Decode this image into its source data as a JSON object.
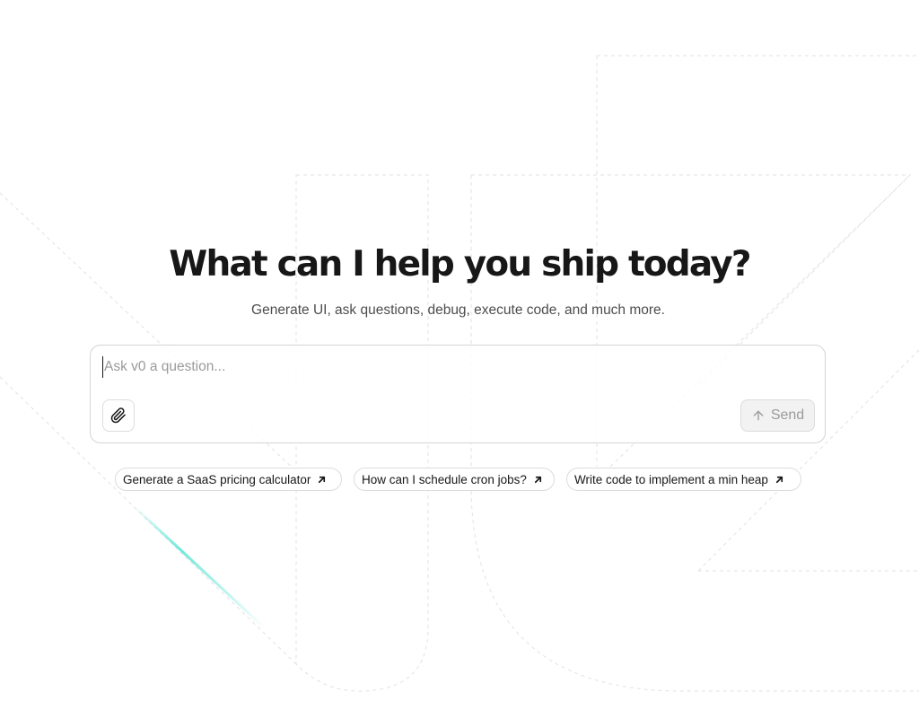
{
  "hero": {
    "title": "What can I help you ship today?",
    "subtitle": "Generate UI, ask questions, debug, execute code, and much more."
  },
  "composer": {
    "input_placeholder": "Ask v0 a question...",
    "input_value": "",
    "attach_icon": "paperclip-icon",
    "send_label": "Send",
    "send_icon": "arrow-up-icon",
    "send_enabled": false
  },
  "suggestions": [
    {
      "label": "Generate a SaaS pricing calculator",
      "icon": "arrow-up-right-icon"
    },
    {
      "label": "How can I schedule cron jobs?",
      "icon": "arrow-up-right-icon"
    },
    {
      "label": "Write code to implement a min heap",
      "icon": "arrow-up-right-icon"
    }
  ],
  "colors": {
    "text_primary": "#171717",
    "text_secondary": "#4d4d4d",
    "placeholder": "#9a9a9a",
    "border": "#d4d4d4",
    "send_disabled_bg": "#f2f2f2",
    "accent_glow": "#5ee6d6"
  }
}
